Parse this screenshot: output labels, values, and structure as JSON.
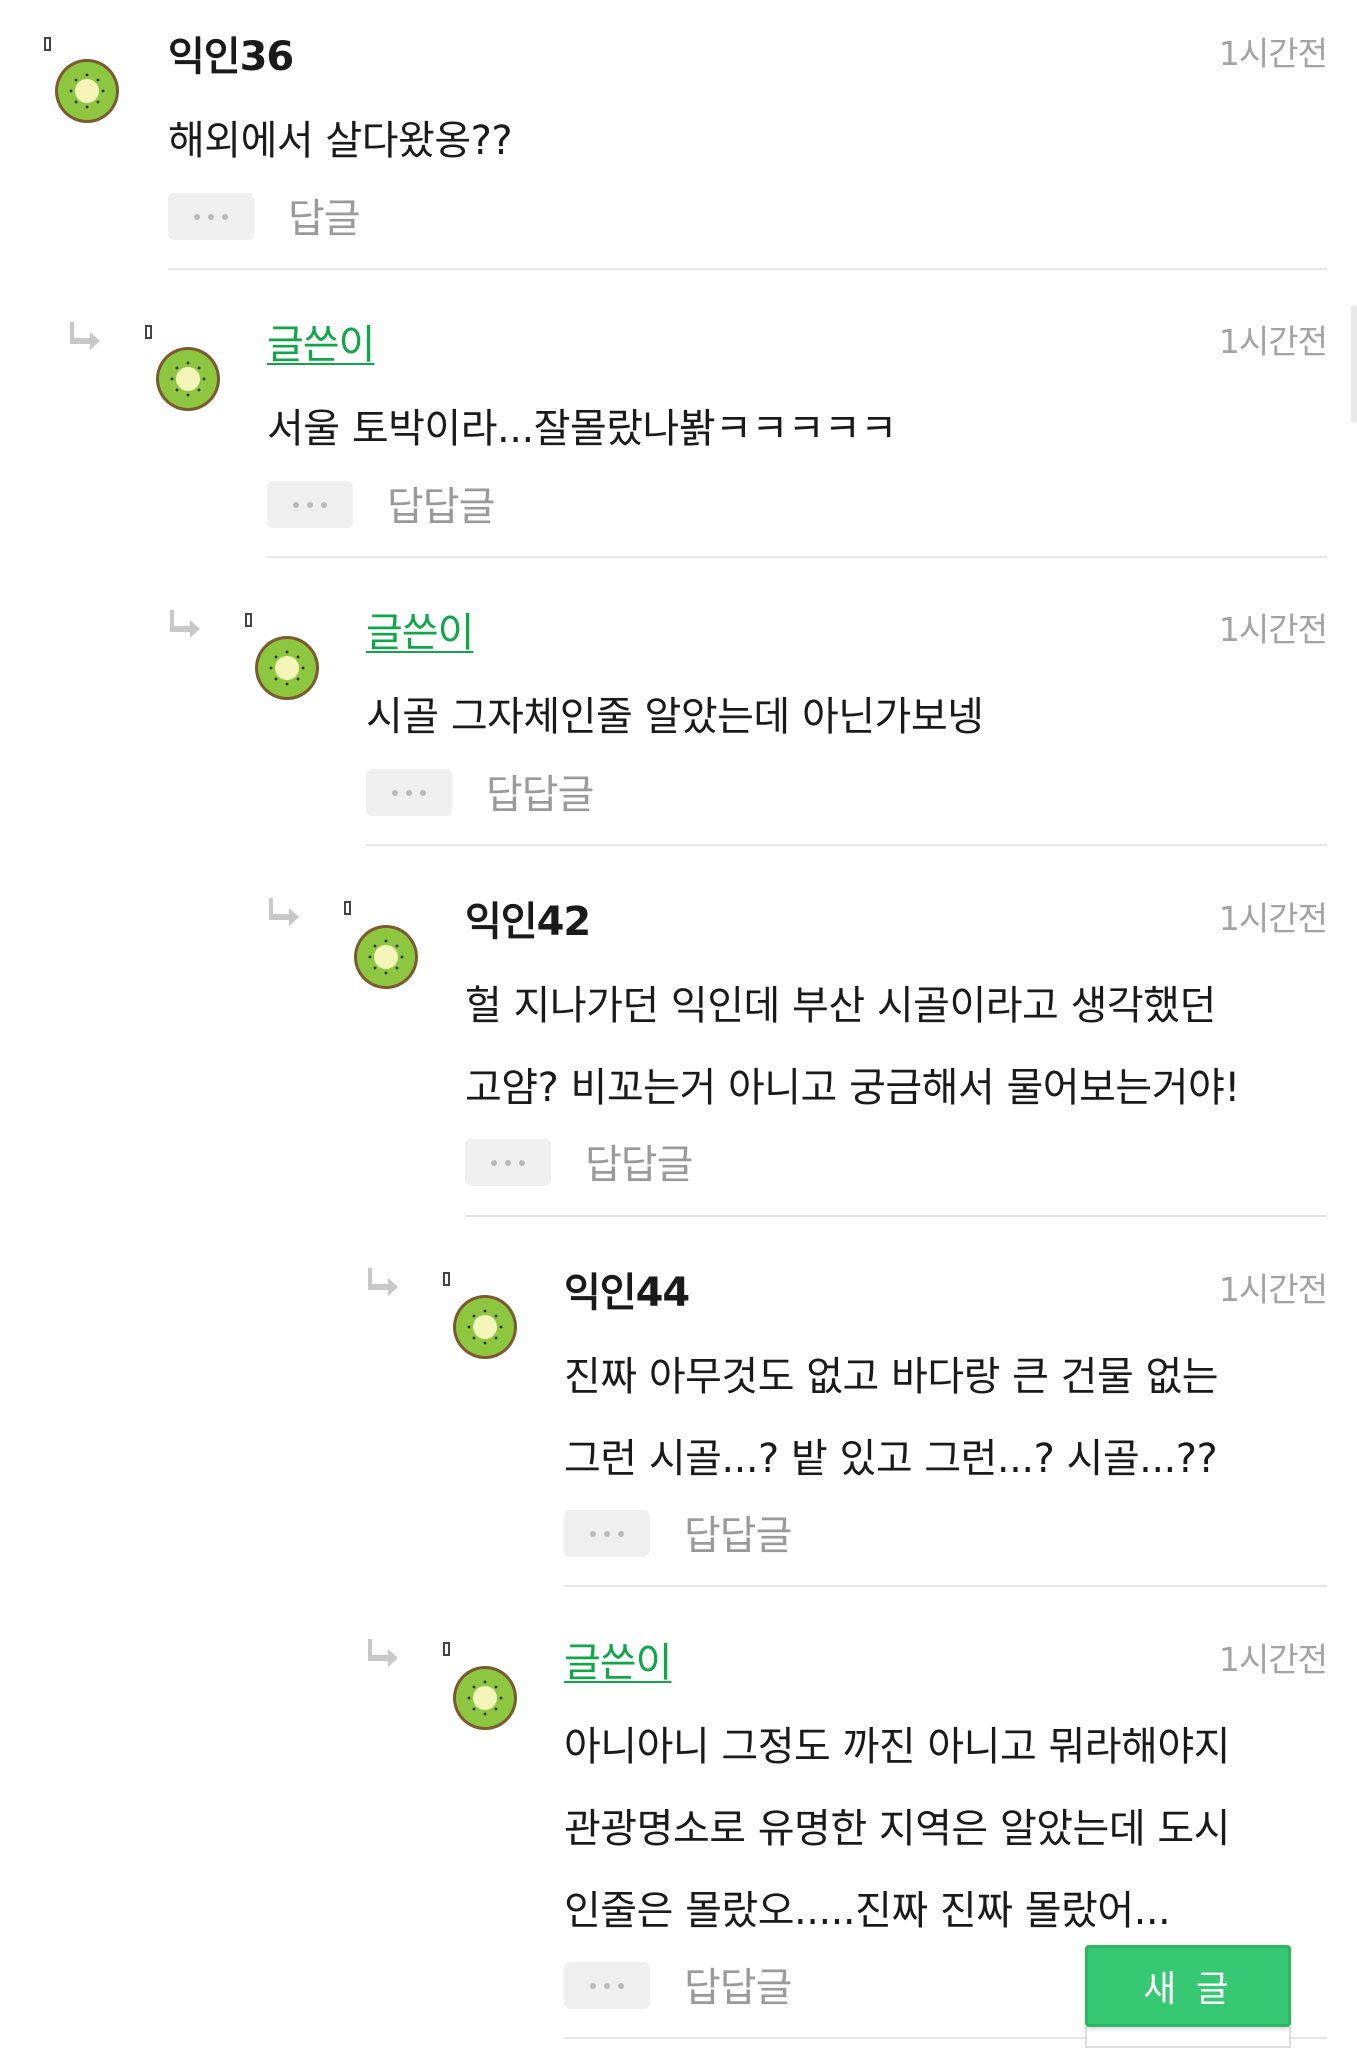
{
  "comments": [
    {
      "author": "익인36",
      "is_op": false,
      "time": "1시간전",
      "body": "해외에서 살다왔옹??",
      "reply_label": "답글"
    },
    {
      "author": "글쓴이",
      "is_op": true,
      "time": "1시간전",
      "body": "서울 토박이라...잘몰랐나봙ㅋㅋㅋㅋㅋ",
      "reply_label": "답답글"
    },
    {
      "author": "글쓴이",
      "is_op": true,
      "time": "1시간전",
      "body": "시골 그자체인줄 알았는데 아닌가보넹",
      "reply_label": "답답글"
    },
    {
      "author": "익인42",
      "is_op": false,
      "time": "1시간전",
      "body": "헐 지나가던 익인데 부산 시골이라고 생각했던\n고얌? 비꼬는거 아니고 궁금해서 물어보는거야!",
      "reply_label": "답답글"
    },
    {
      "author": "익인44",
      "is_op": false,
      "time": "1시간전",
      "body": "진짜 아무것도 없고 바다랑 큰 건물 없는\n그런 시골...? 밭 있고 그런...? 시골...??",
      "reply_label": "답답글"
    },
    {
      "author": "글쓴이",
      "is_op": true,
      "time": "1시간전",
      "body": "아니아니 그정도 까진 아니고 뭐라해야지\n관광명소로 유명한 지역은 알았는데 도시\n인줄은 몰랐오.....진짜 진짜 몰랐어...",
      "reply_label": "답답글"
    }
  ],
  "new_post_button": "새 글",
  "colors": {
    "op_name": "#12a64a",
    "new_post_bg": "#36c872",
    "timestamp": "#a3a3a3",
    "kiwi_flesh": "#8dc63f",
    "kiwi_skin": "#7a5a2e"
  },
  "icons": {
    "avatar": "kiwi-avatar-icon",
    "reply_indent": "reply-arrow-icon",
    "more": "more-dots-icon"
  }
}
